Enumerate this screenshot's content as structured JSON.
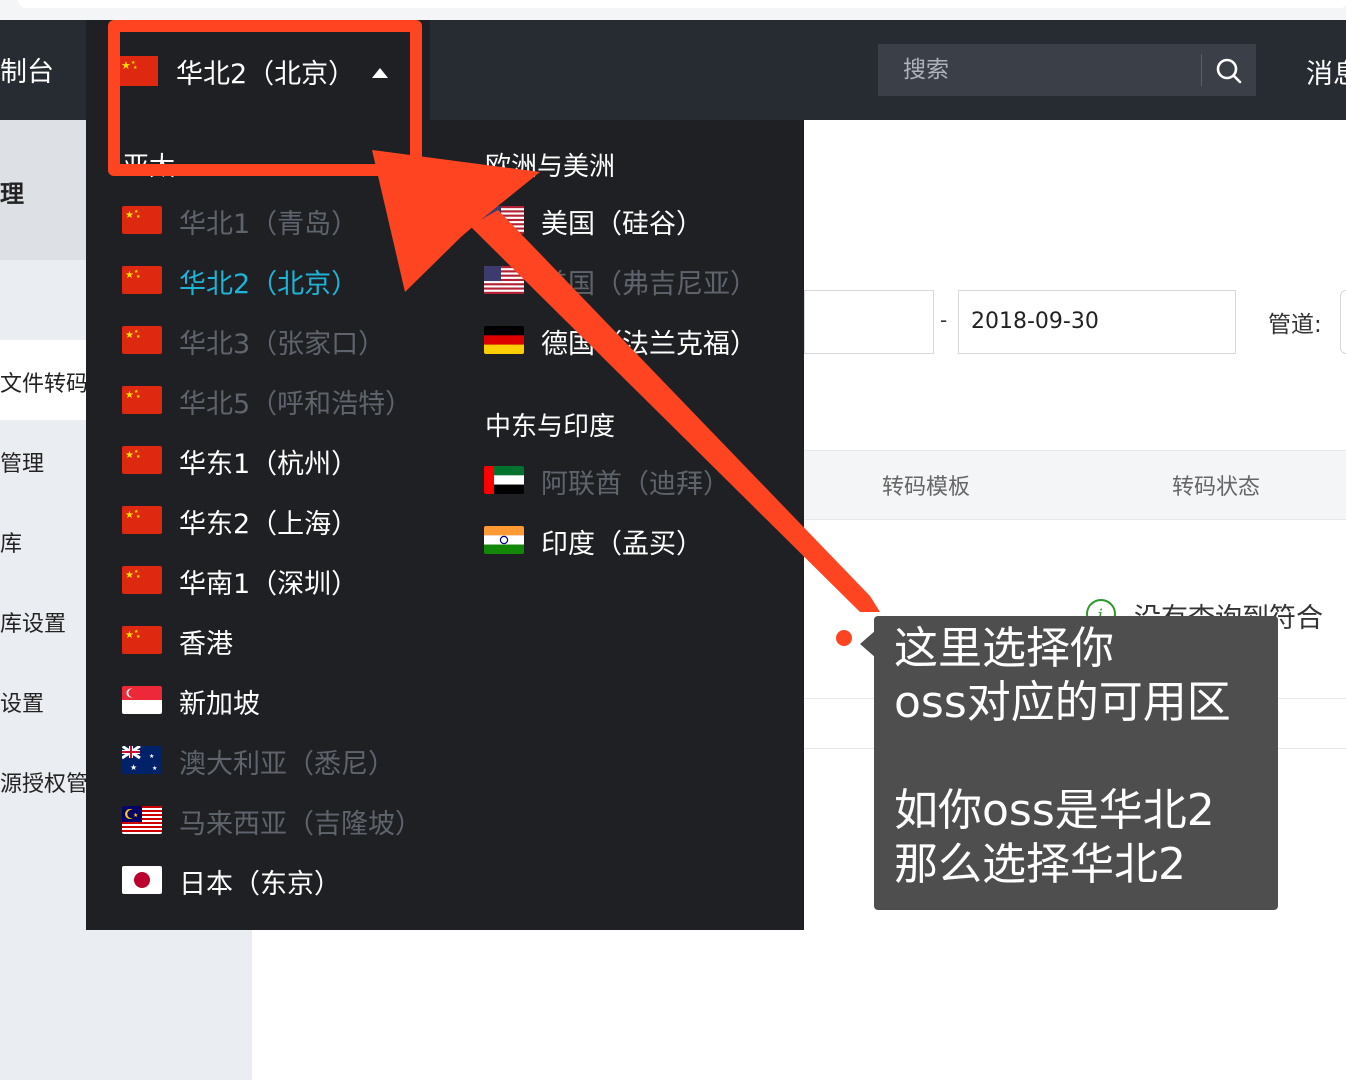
{
  "topnav": {
    "console_title": "控制台",
    "selected_region": "华北2（北京）",
    "search_placeholder": "搜索",
    "messages": "消息"
  },
  "sidebar": {
    "section_title": "处理",
    "items": [
      "文件转码",
      "管理",
      "本库",
      "本库设置",
      "设置",
      "源授权管"
    ]
  },
  "filters": {
    "date_end": "2018-09-30",
    "date_separator": "-",
    "pipeline_label": "管道:"
  },
  "table": {
    "headers": [
      "转码模板",
      "转码状态"
    ],
    "empty_message": "没有查询到符合"
  },
  "dropdown": {
    "asia_title": "亚太",
    "asia_regions": [
      {
        "label": "华北1（青岛）",
        "flag": "cn-flag",
        "state": "disabled"
      },
      {
        "label": "华北2（北京）",
        "flag": "cn-flag",
        "state": "active"
      },
      {
        "label": "华北3（张家口）",
        "flag": "cn-flag",
        "state": "disabled"
      },
      {
        "label": "华北5（呼和浩特）",
        "flag": "cn-flag",
        "state": "disabled"
      },
      {
        "label": "华东1（杭州）",
        "flag": "cn-flag",
        "state": "normal"
      },
      {
        "label": "华东2（上海）",
        "flag": "cn-flag",
        "state": "normal"
      },
      {
        "label": "华南1（深圳）",
        "flag": "cn-flag",
        "state": "normal"
      },
      {
        "label": "香港",
        "flag": "hk-flag",
        "state": "normal"
      },
      {
        "label": "新加坡",
        "flag": "sg-flag",
        "state": "normal"
      },
      {
        "label": "澳大利亚（悉尼）",
        "flag": "au-flag",
        "state": "disabled"
      },
      {
        "label": "马来西亚（吉隆坡）",
        "flag": "my-flag",
        "state": "disabled"
      },
      {
        "label": "日本（东京）",
        "flag": "jp-flag",
        "state": "normal"
      }
    ],
    "euam_title": "欧洲与美洲",
    "euam_regions": [
      {
        "label": "美国（硅谷）",
        "flag": "us-flag",
        "state": "normal"
      },
      {
        "label": "美国（弗吉尼亚）",
        "flag": "us-flag",
        "state": "disabled"
      },
      {
        "label": "德国（法兰克福）",
        "flag": "de-flag",
        "state": "normal"
      }
    ],
    "mei_title": "中东与印度",
    "mei_regions": [
      {
        "label": "阿联酋（迪拜）",
        "flag": "ae-flag",
        "state": "disabled"
      },
      {
        "label": "印度（孟买）",
        "flag": "in-flag",
        "state": "normal"
      }
    ]
  },
  "annotation": {
    "text": "这里选择你\noss对应的可用区\n\n如你oss是华北2\n那么选择华北2"
  },
  "colors": {
    "nav_bg": "#272c32",
    "dropdown_bg": "#1e2024",
    "active_region": "#1eb4d8",
    "disabled_region": "#5f646c",
    "annotation_red": "#fe4421"
  }
}
